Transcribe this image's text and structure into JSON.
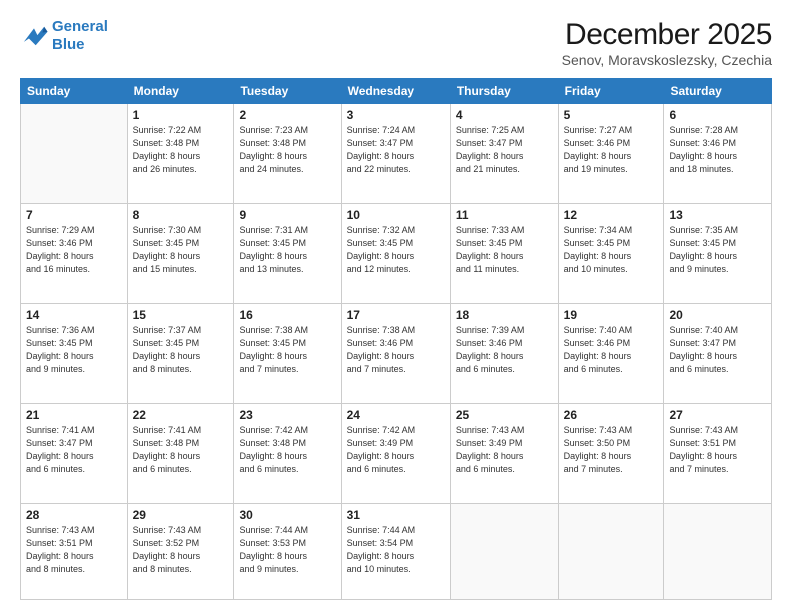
{
  "logo": {
    "line1": "General",
    "line2": "Blue"
  },
  "header": {
    "month_year": "December 2025",
    "location": "Senov, Moravskoslezsky, Czechia"
  },
  "days_of_week": [
    "Sunday",
    "Monday",
    "Tuesday",
    "Wednesday",
    "Thursday",
    "Friday",
    "Saturday"
  ],
  "weeks": [
    [
      {
        "day": "",
        "info": ""
      },
      {
        "day": "1",
        "info": "Sunrise: 7:22 AM\nSunset: 3:48 PM\nDaylight: 8 hours\nand 26 minutes."
      },
      {
        "day": "2",
        "info": "Sunrise: 7:23 AM\nSunset: 3:48 PM\nDaylight: 8 hours\nand 24 minutes."
      },
      {
        "day": "3",
        "info": "Sunrise: 7:24 AM\nSunset: 3:47 PM\nDaylight: 8 hours\nand 22 minutes."
      },
      {
        "day": "4",
        "info": "Sunrise: 7:25 AM\nSunset: 3:47 PM\nDaylight: 8 hours\nand 21 minutes."
      },
      {
        "day": "5",
        "info": "Sunrise: 7:27 AM\nSunset: 3:46 PM\nDaylight: 8 hours\nand 19 minutes."
      },
      {
        "day": "6",
        "info": "Sunrise: 7:28 AM\nSunset: 3:46 PM\nDaylight: 8 hours\nand 18 minutes."
      }
    ],
    [
      {
        "day": "7",
        "info": "Sunrise: 7:29 AM\nSunset: 3:46 PM\nDaylight: 8 hours\nand 16 minutes."
      },
      {
        "day": "8",
        "info": "Sunrise: 7:30 AM\nSunset: 3:45 PM\nDaylight: 8 hours\nand 15 minutes."
      },
      {
        "day": "9",
        "info": "Sunrise: 7:31 AM\nSunset: 3:45 PM\nDaylight: 8 hours\nand 13 minutes."
      },
      {
        "day": "10",
        "info": "Sunrise: 7:32 AM\nSunset: 3:45 PM\nDaylight: 8 hours\nand 12 minutes."
      },
      {
        "day": "11",
        "info": "Sunrise: 7:33 AM\nSunset: 3:45 PM\nDaylight: 8 hours\nand 11 minutes."
      },
      {
        "day": "12",
        "info": "Sunrise: 7:34 AM\nSunset: 3:45 PM\nDaylight: 8 hours\nand 10 minutes."
      },
      {
        "day": "13",
        "info": "Sunrise: 7:35 AM\nSunset: 3:45 PM\nDaylight: 8 hours\nand 9 minutes."
      }
    ],
    [
      {
        "day": "14",
        "info": "Sunrise: 7:36 AM\nSunset: 3:45 PM\nDaylight: 8 hours\nand 9 minutes."
      },
      {
        "day": "15",
        "info": "Sunrise: 7:37 AM\nSunset: 3:45 PM\nDaylight: 8 hours\nand 8 minutes."
      },
      {
        "day": "16",
        "info": "Sunrise: 7:38 AM\nSunset: 3:45 PM\nDaylight: 8 hours\nand 7 minutes."
      },
      {
        "day": "17",
        "info": "Sunrise: 7:38 AM\nSunset: 3:46 PM\nDaylight: 8 hours\nand 7 minutes."
      },
      {
        "day": "18",
        "info": "Sunrise: 7:39 AM\nSunset: 3:46 PM\nDaylight: 8 hours\nand 6 minutes."
      },
      {
        "day": "19",
        "info": "Sunrise: 7:40 AM\nSunset: 3:46 PM\nDaylight: 8 hours\nand 6 minutes."
      },
      {
        "day": "20",
        "info": "Sunrise: 7:40 AM\nSunset: 3:47 PM\nDaylight: 8 hours\nand 6 minutes."
      }
    ],
    [
      {
        "day": "21",
        "info": "Sunrise: 7:41 AM\nSunset: 3:47 PM\nDaylight: 8 hours\nand 6 minutes."
      },
      {
        "day": "22",
        "info": "Sunrise: 7:41 AM\nSunset: 3:48 PM\nDaylight: 8 hours\nand 6 minutes."
      },
      {
        "day": "23",
        "info": "Sunrise: 7:42 AM\nSunset: 3:48 PM\nDaylight: 8 hours\nand 6 minutes."
      },
      {
        "day": "24",
        "info": "Sunrise: 7:42 AM\nSunset: 3:49 PM\nDaylight: 8 hours\nand 6 minutes."
      },
      {
        "day": "25",
        "info": "Sunrise: 7:43 AM\nSunset: 3:49 PM\nDaylight: 8 hours\nand 6 minutes."
      },
      {
        "day": "26",
        "info": "Sunrise: 7:43 AM\nSunset: 3:50 PM\nDaylight: 8 hours\nand 7 minutes."
      },
      {
        "day": "27",
        "info": "Sunrise: 7:43 AM\nSunset: 3:51 PM\nDaylight: 8 hours\nand 7 minutes."
      }
    ],
    [
      {
        "day": "28",
        "info": "Sunrise: 7:43 AM\nSunset: 3:51 PM\nDaylight: 8 hours\nand 8 minutes."
      },
      {
        "day": "29",
        "info": "Sunrise: 7:43 AM\nSunset: 3:52 PM\nDaylight: 8 hours\nand 8 minutes."
      },
      {
        "day": "30",
        "info": "Sunrise: 7:44 AM\nSunset: 3:53 PM\nDaylight: 8 hours\nand 9 minutes."
      },
      {
        "day": "31",
        "info": "Sunrise: 7:44 AM\nSunset: 3:54 PM\nDaylight: 8 hours\nand 10 minutes."
      },
      {
        "day": "",
        "info": ""
      },
      {
        "day": "",
        "info": ""
      },
      {
        "day": "",
        "info": ""
      }
    ]
  ]
}
